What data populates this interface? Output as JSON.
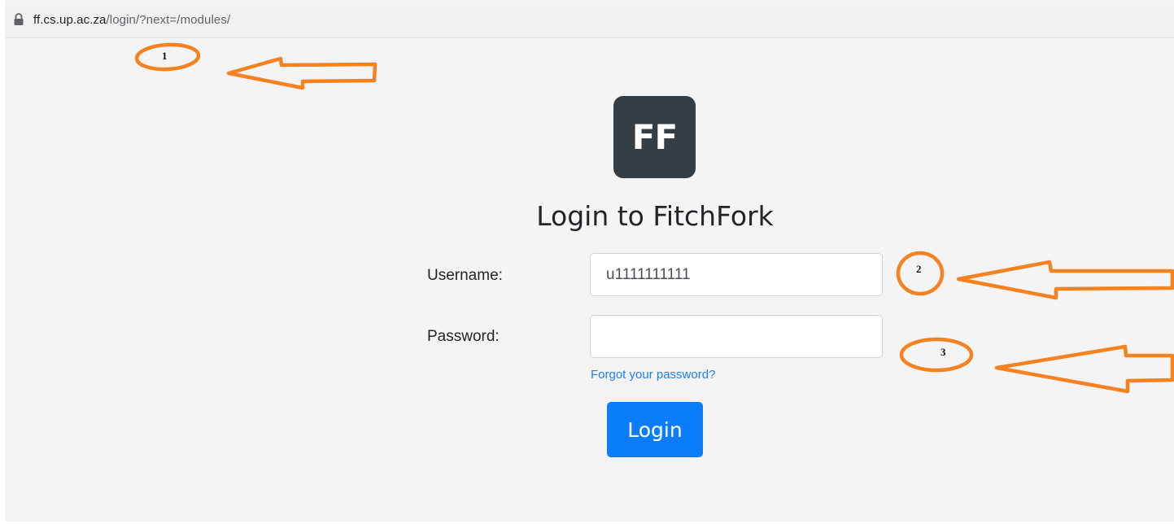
{
  "browser": {
    "url_host": "ff.cs.up.ac.za",
    "url_path": "/login/?next=/modules/",
    "lock_icon": "lock-icon"
  },
  "login": {
    "logo_text": "FF",
    "title": "Login to FitchFork",
    "username_label": "Username:",
    "username_value": "u1111111111",
    "password_label": "Password:",
    "password_value": "",
    "forgot_link": "Forgot your password?",
    "login_button": "Login"
  },
  "annotations": {
    "marker_1": "1",
    "marker_2": "2",
    "marker_3": "3"
  },
  "colors": {
    "annotation_orange": "#f58220",
    "logo_background": "#343e44",
    "button_blue": "#0b7dfa",
    "link_blue": "#1a7ef5",
    "page_background": "#f4f4f5"
  }
}
